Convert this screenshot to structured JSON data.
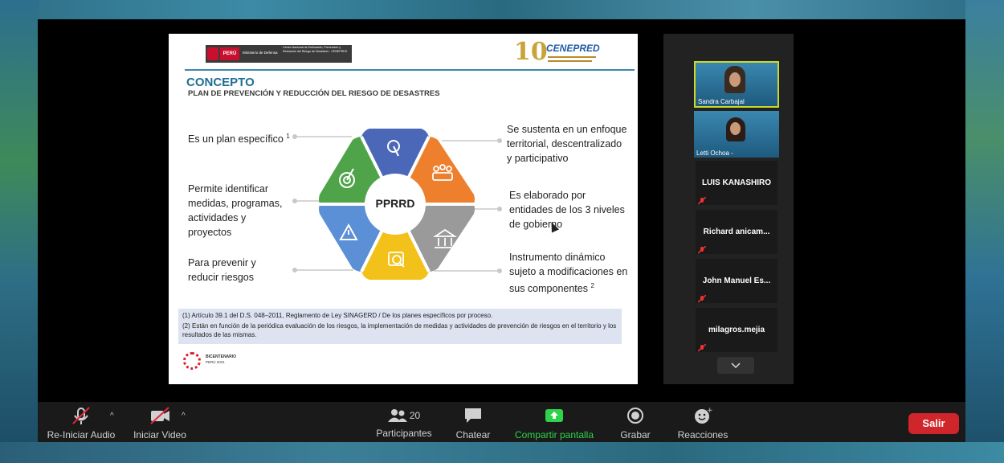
{
  "slide": {
    "header_gov_label": "PERÚ",
    "header_ministry": "Ministerio de Defensa",
    "header_center": "Centro Nacional de Estimación, Prevención y Reducción del Riesgo de Desastres - CENEPRED",
    "logo_text": "CENEPRED",
    "title": "CONCEPTO",
    "subtitle": "PLAN DE PREVENCIÓN Y REDUCCIÓN DEL RIESGO DE DESASTRES",
    "center_label": "PPRRD",
    "left_items": [
      {
        "text": "Es un plan específico",
        "sup": "1"
      },
      {
        "text": "Permite identificar medidas, programas, actividades y proyectos"
      },
      {
        "text": "Para prevenir y reducir riesgos"
      }
    ],
    "right_items": [
      {
        "text": "Se sustenta en un enfoque territorial, descentralizado y participativo"
      },
      {
        "text": "Es elaborado por entidades de los 3 niveles de gobierno"
      },
      {
        "text": "Instrumento dinámico sujeto a modificaciones en sus componentes",
        "sup": "2"
      }
    ],
    "footnote1": "(1) Artículo 39.1 del D.S. 048–2011, Reglamento de Ley SINAGERD / De los planes específicos por proceso.",
    "footnote2": "(2) Están en función de la periódica evaluación de los riesgos, la implementación de medidas y actividades de prevención de riesgos en el territorio y los resultados de las mismas.",
    "bicentenario": "BICENTENARIO",
    "bicentenario_sub": "PERÚ 2021",
    "colors": {
      "green": "#4fa44a",
      "blue": "#4a67b8",
      "orange": "#ee7f2d",
      "gray": "#9a9a9a",
      "yellow": "#f3c21a",
      "lightblue": "#5b8fd6",
      "title": "#1f6f93"
    }
  },
  "participants": {
    "video": [
      {
        "name": "Sandra Carbajal"
      },
      {
        "name": "Letti Ochoa -"
      }
    ],
    "tiles": [
      {
        "name": "LUIS KANASHIRO"
      },
      {
        "name": "Richard anicam..."
      },
      {
        "name": "John Manuel Es..."
      },
      {
        "name": "milagros.mejia"
      }
    ]
  },
  "toolbar": {
    "audio_label": "Re-Iniciar Audio",
    "video_label": "Iniciar Video",
    "participants_label": "Participantes",
    "participants_count": "20",
    "chat_label": "Chatear",
    "share_label": "Compartir pantalla",
    "record_label": "Grabar",
    "reactions_label": "Reacciones",
    "leave_label": "Salir",
    "share_color": "#2fd34a",
    "leave_color": "#d0252b"
  }
}
